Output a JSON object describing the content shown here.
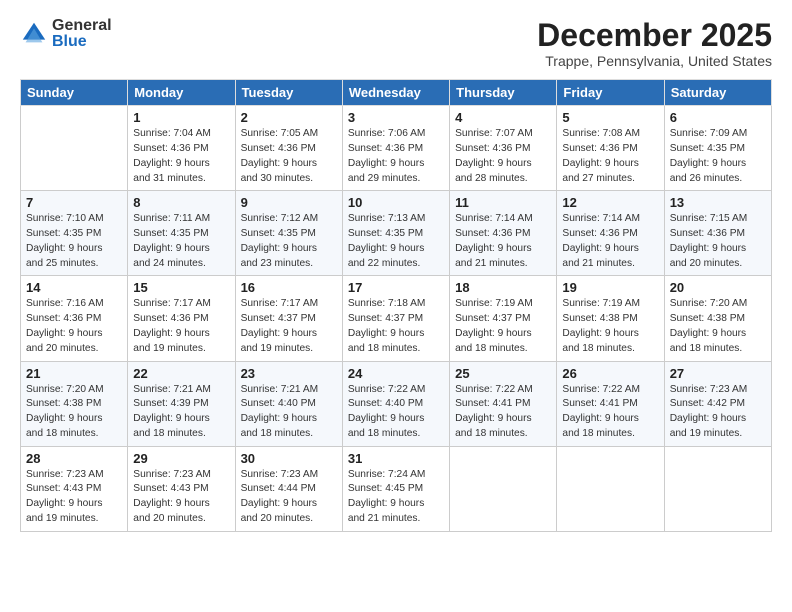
{
  "logo": {
    "general": "General",
    "blue": "Blue"
  },
  "title": "December 2025",
  "location": "Trappe, Pennsylvania, United States",
  "days_of_week": [
    "Sunday",
    "Monday",
    "Tuesday",
    "Wednesday",
    "Thursday",
    "Friday",
    "Saturday"
  ],
  "weeks": [
    [
      {
        "day": "",
        "content": ""
      },
      {
        "day": "1",
        "content": "Sunrise: 7:04 AM\nSunset: 4:36 PM\nDaylight: 9 hours\nand 31 minutes."
      },
      {
        "day": "2",
        "content": "Sunrise: 7:05 AM\nSunset: 4:36 PM\nDaylight: 9 hours\nand 30 minutes."
      },
      {
        "day": "3",
        "content": "Sunrise: 7:06 AM\nSunset: 4:36 PM\nDaylight: 9 hours\nand 29 minutes."
      },
      {
        "day": "4",
        "content": "Sunrise: 7:07 AM\nSunset: 4:36 PM\nDaylight: 9 hours\nand 28 minutes."
      },
      {
        "day": "5",
        "content": "Sunrise: 7:08 AM\nSunset: 4:36 PM\nDaylight: 9 hours\nand 27 minutes."
      },
      {
        "day": "6",
        "content": "Sunrise: 7:09 AM\nSunset: 4:35 PM\nDaylight: 9 hours\nand 26 minutes."
      }
    ],
    [
      {
        "day": "7",
        "content": "Sunrise: 7:10 AM\nSunset: 4:35 PM\nDaylight: 9 hours\nand 25 minutes."
      },
      {
        "day": "8",
        "content": "Sunrise: 7:11 AM\nSunset: 4:35 PM\nDaylight: 9 hours\nand 24 minutes."
      },
      {
        "day": "9",
        "content": "Sunrise: 7:12 AM\nSunset: 4:35 PM\nDaylight: 9 hours\nand 23 minutes."
      },
      {
        "day": "10",
        "content": "Sunrise: 7:13 AM\nSunset: 4:35 PM\nDaylight: 9 hours\nand 22 minutes."
      },
      {
        "day": "11",
        "content": "Sunrise: 7:14 AM\nSunset: 4:36 PM\nDaylight: 9 hours\nand 21 minutes."
      },
      {
        "day": "12",
        "content": "Sunrise: 7:14 AM\nSunset: 4:36 PM\nDaylight: 9 hours\nand 21 minutes."
      },
      {
        "day": "13",
        "content": "Sunrise: 7:15 AM\nSunset: 4:36 PM\nDaylight: 9 hours\nand 20 minutes."
      }
    ],
    [
      {
        "day": "14",
        "content": "Sunrise: 7:16 AM\nSunset: 4:36 PM\nDaylight: 9 hours\nand 20 minutes."
      },
      {
        "day": "15",
        "content": "Sunrise: 7:17 AM\nSunset: 4:36 PM\nDaylight: 9 hours\nand 19 minutes."
      },
      {
        "day": "16",
        "content": "Sunrise: 7:17 AM\nSunset: 4:37 PM\nDaylight: 9 hours\nand 19 minutes."
      },
      {
        "day": "17",
        "content": "Sunrise: 7:18 AM\nSunset: 4:37 PM\nDaylight: 9 hours\nand 18 minutes."
      },
      {
        "day": "18",
        "content": "Sunrise: 7:19 AM\nSunset: 4:37 PM\nDaylight: 9 hours\nand 18 minutes."
      },
      {
        "day": "19",
        "content": "Sunrise: 7:19 AM\nSunset: 4:38 PM\nDaylight: 9 hours\nand 18 minutes."
      },
      {
        "day": "20",
        "content": "Sunrise: 7:20 AM\nSunset: 4:38 PM\nDaylight: 9 hours\nand 18 minutes."
      }
    ],
    [
      {
        "day": "21",
        "content": "Sunrise: 7:20 AM\nSunset: 4:38 PM\nDaylight: 9 hours\nand 18 minutes."
      },
      {
        "day": "22",
        "content": "Sunrise: 7:21 AM\nSunset: 4:39 PM\nDaylight: 9 hours\nand 18 minutes."
      },
      {
        "day": "23",
        "content": "Sunrise: 7:21 AM\nSunset: 4:40 PM\nDaylight: 9 hours\nand 18 minutes."
      },
      {
        "day": "24",
        "content": "Sunrise: 7:22 AM\nSunset: 4:40 PM\nDaylight: 9 hours\nand 18 minutes."
      },
      {
        "day": "25",
        "content": "Sunrise: 7:22 AM\nSunset: 4:41 PM\nDaylight: 9 hours\nand 18 minutes."
      },
      {
        "day": "26",
        "content": "Sunrise: 7:22 AM\nSunset: 4:41 PM\nDaylight: 9 hours\nand 18 minutes."
      },
      {
        "day": "27",
        "content": "Sunrise: 7:23 AM\nSunset: 4:42 PM\nDaylight: 9 hours\nand 19 minutes."
      }
    ],
    [
      {
        "day": "28",
        "content": "Sunrise: 7:23 AM\nSunset: 4:43 PM\nDaylight: 9 hours\nand 19 minutes."
      },
      {
        "day": "29",
        "content": "Sunrise: 7:23 AM\nSunset: 4:43 PM\nDaylight: 9 hours\nand 20 minutes."
      },
      {
        "day": "30",
        "content": "Sunrise: 7:23 AM\nSunset: 4:44 PM\nDaylight: 9 hours\nand 20 minutes."
      },
      {
        "day": "31",
        "content": "Sunrise: 7:24 AM\nSunset: 4:45 PM\nDaylight: 9 hours\nand 21 minutes."
      },
      {
        "day": "",
        "content": ""
      },
      {
        "day": "",
        "content": ""
      },
      {
        "day": "",
        "content": ""
      }
    ]
  ]
}
